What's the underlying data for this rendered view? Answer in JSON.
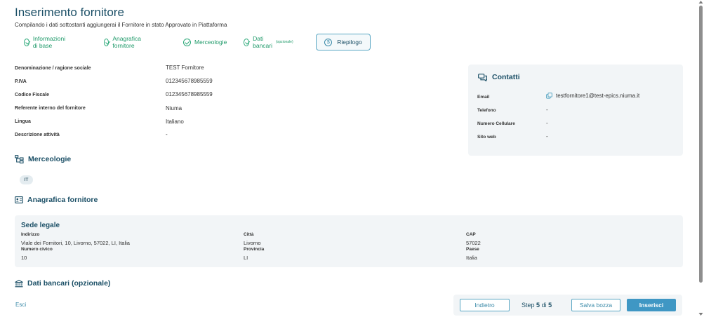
{
  "header": {
    "title": "Inserimento fornitore",
    "subtitle": "Compilando i dati sottostanti aggiungerai il Fornitore in stato Approvato in Piattaforma"
  },
  "stepper": {
    "steps": [
      {
        "label": "Informazioni di base",
        "status": "completed"
      },
      {
        "label": "Anagrafica fornitore",
        "status": "completed"
      },
      {
        "label": "Merceologie",
        "status": "completed"
      },
      {
        "label": "Dati bancari",
        "note": "(opzionale)",
        "status": "completed"
      },
      {
        "label": "Riepilogo",
        "status": "active"
      }
    ]
  },
  "info": {
    "fields": [
      {
        "label": "Denominazione / ragione sociale",
        "value": "TEST Fornitore"
      },
      {
        "label": "P.IVA",
        "value": "012345678985559"
      },
      {
        "label": "Codice Fiscale",
        "value": "012345678985559"
      },
      {
        "label": "Referente interno del fornitore",
        "value": "Niuma"
      },
      {
        "label": "Lingua",
        "value": "Italiano"
      },
      {
        "label": "Descrizione attività",
        "value": "-"
      }
    ]
  },
  "contatti": {
    "title": "Contatti",
    "fields": [
      {
        "label": "Email",
        "value": "testfornitore1@test-epics.niuma.it"
      },
      {
        "label": "Telefono",
        "value": "-"
      },
      {
        "label": "Numero Cellulare",
        "value": "-"
      },
      {
        "label": "Sito web",
        "value": "-"
      }
    ]
  },
  "merceologie": {
    "title": "Merceologie",
    "chips": [
      "IT"
    ]
  },
  "anagrafica": {
    "title": "Anagrafica fornitore",
    "sede": {
      "title": "Sede legale",
      "indirizzo_label": "Indirizzo",
      "indirizzo": "Viale dei Fornitori, 10, Livorno, 57022, LI, Italia",
      "citta_label": "Città",
      "citta": "Livorno",
      "cap_label": "CAP",
      "cap": "57022",
      "civico_label": "Numero civico",
      "civico": "10",
      "provincia_label": "Provincia",
      "provincia": "LI",
      "paese_label": "Paese",
      "paese": "Italia"
    }
  },
  "dati_bancari": {
    "title": "Dati bancari (opzionale)"
  },
  "footer": {
    "esci": "Esci",
    "indietro": "Indietro",
    "step_prefix": "Step",
    "step_current": "5",
    "step_sep": "di",
    "step_total": "5",
    "salva_bozza": "Salva bozza",
    "inserisci": "Inserisci"
  },
  "colors": {
    "primary": "#1b4f66",
    "accent": "#3f97c4",
    "success": "#2aa878",
    "card_bg": "#f2f5f7"
  }
}
